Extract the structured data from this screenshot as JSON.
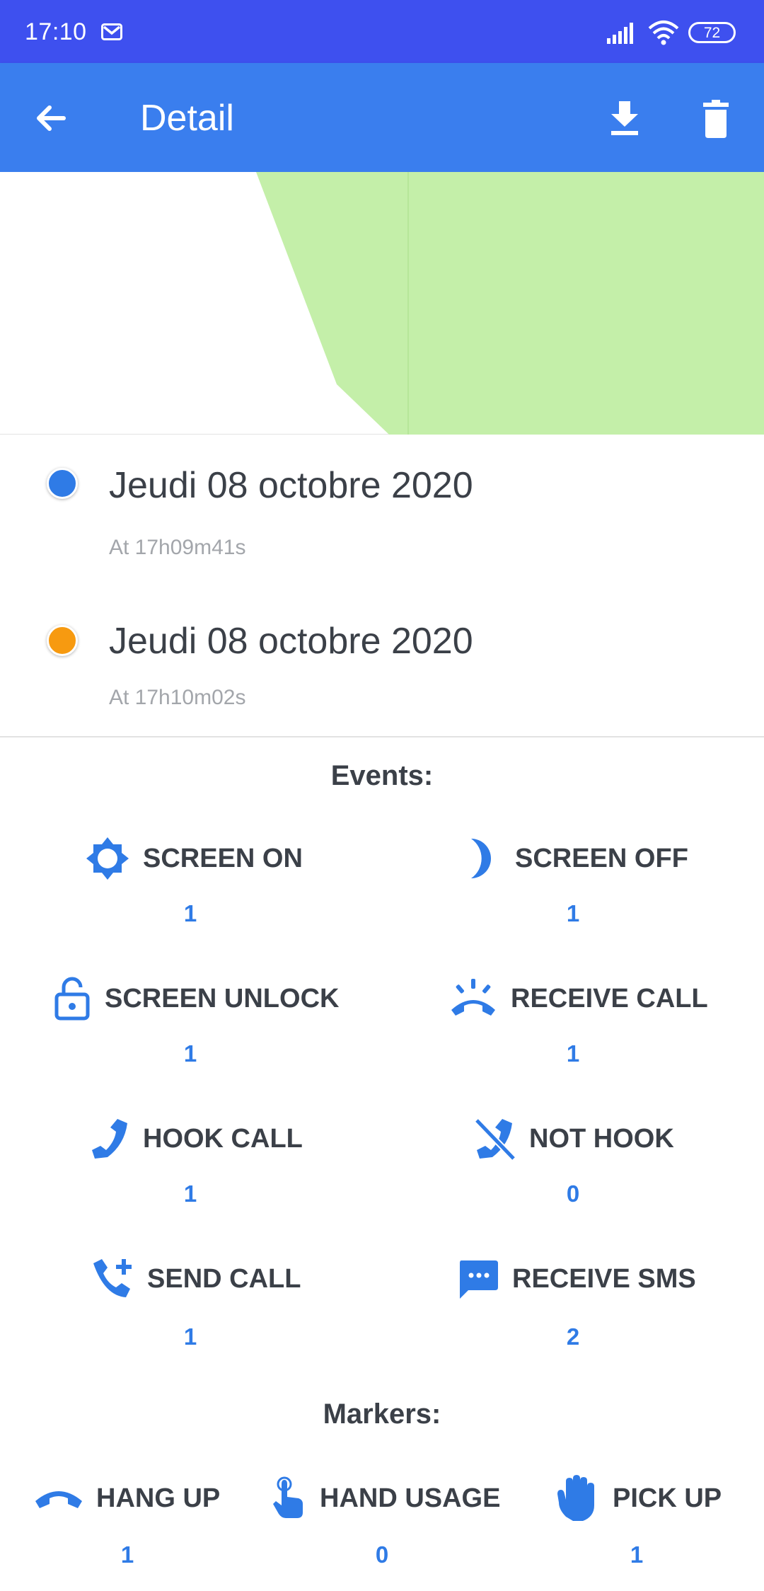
{
  "status_bar": {
    "time": "17:10",
    "battery": "72",
    "icons": [
      "mail-icon",
      "signal-icon",
      "wifi-icon",
      "battery-icon"
    ]
  },
  "app_bar": {
    "title": "Detail",
    "icons": [
      "back-arrow-icon",
      "download-icon",
      "trash-icon"
    ]
  },
  "map": {
    "fill_color": "#C4EFA9"
  },
  "timeline": [
    {
      "date": "Jeudi 08 octobre 2020",
      "time": "At 17h09m41s",
      "dot_color": "#2F7BE6"
    },
    {
      "date": "Jeudi 08 octobre 2020",
      "time": "At 17h10m02s",
      "dot_color": "#F79A10"
    }
  ],
  "events": {
    "title": "Events:",
    "items": [
      {
        "label": "SCREEN ON",
        "count": "1",
        "icon": "brightness-icon"
      },
      {
        "label": "SCREEN OFF",
        "count": "1",
        "icon": "moon-icon"
      },
      {
        "label": "SCREEN UNLOCK",
        "count": "1",
        "icon": "unlock-icon"
      },
      {
        "label": "RECEIVE CALL",
        "count": "1",
        "icon": "ringing-phone-icon"
      },
      {
        "label": "HOOK CALL",
        "count": "1",
        "icon": "phone-icon"
      },
      {
        "label": "NOT HOOK",
        "count": "0",
        "icon": "phone-missed-icon"
      },
      {
        "label": "SEND CALL",
        "count": "1",
        "icon": "phone-add-icon"
      },
      {
        "label": "RECEIVE SMS",
        "count": "2",
        "icon": "sms-icon"
      }
    ]
  },
  "markers": {
    "title": "Markers:",
    "items": [
      {
        "label": "HANG UP",
        "count": "1",
        "icon": "hang-up-icon"
      },
      {
        "label": "HAND USAGE",
        "count": "0",
        "icon": "touch-hand-icon"
      },
      {
        "label": "PICK UP",
        "count": "1",
        "icon": "palm-hand-icon"
      }
    ]
  },
  "colors": {
    "status_bar": "#3E50EF",
    "app_bar": "#3A7EEE",
    "accent": "#2F7BE6",
    "text": "#3B4048",
    "secondary_text": "#A3A6AB"
  }
}
